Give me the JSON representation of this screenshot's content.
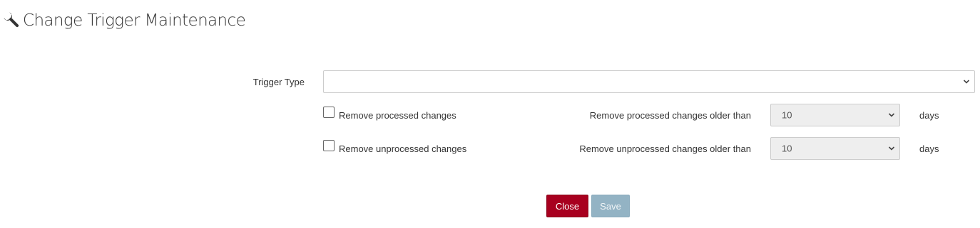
{
  "header": {
    "title": "Change Trigger Maintenance",
    "icon": "wrench-icon"
  },
  "form": {
    "trigger_type": {
      "label": "Trigger Type",
      "value": ""
    },
    "processed": {
      "checkbox_label": "Remove processed changes",
      "checked": false,
      "older_than_label": "Remove processed changes older than",
      "value": "10",
      "unit": "days"
    },
    "unprocessed": {
      "checkbox_label": "Remove unprocessed changes",
      "checked": false,
      "older_than_label": "Remove unprocessed changes older than",
      "value": "10",
      "unit": "days"
    }
  },
  "buttons": {
    "close_label": "Close",
    "save_label": "Save",
    "close_color": "#a8001f",
    "save_color": "#93b3c4"
  }
}
